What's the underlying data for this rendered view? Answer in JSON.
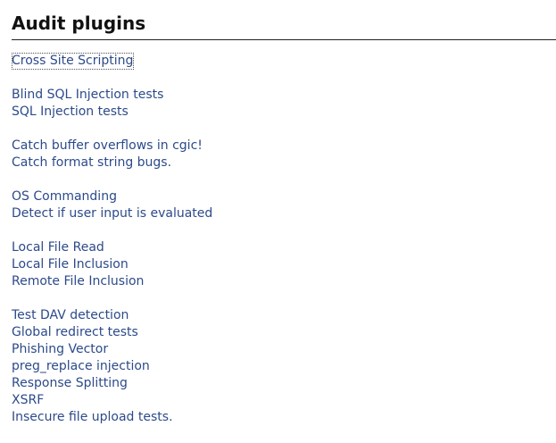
{
  "title": "Audit plugins",
  "groups": [
    {
      "items": [
        "Cross Site Scripting"
      ]
    },
    {
      "items": [
        "Blind SQL Injection tests",
        "SQL Injection tests"
      ]
    },
    {
      "items": [
        "Catch buffer overflows in cgic!",
        "Catch format string bugs."
      ]
    },
    {
      "items": [
        "OS Commanding",
        "Detect if user input is evaluated"
      ]
    },
    {
      "items": [
        "Local File Read",
        "Local File Inclusion",
        "Remote File Inclusion"
      ]
    },
    {
      "items": [
        "Test DAV detection",
        "Global redirect tests",
        "Phishing Vector",
        "preg_replace injection",
        "Response Splitting",
        "XSRF",
        "Insecure file upload tests."
      ]
    }
  ],
  "link_color": "#2c4a8a"
}
